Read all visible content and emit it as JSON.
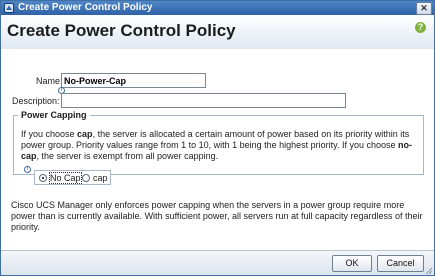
{
  "window": {
    "title": "Create Power Control Policy"
  },
  "header": {
    "title": "Create Power Control Policy"
  },
  "form": {
    "name_label": "Name:",
    "name_value": "No-Power-Cap",
    "description_label": "Description:",
    "description_value": ""
  },
  "power_capping": {
    "legend": "Power Capping",
    "text_1": "If you choose ",
    "bold_1": "cap",
    "text_2": ", the server is allocated a certain amount of power based on its priority within its power group. Priority values range from 1 to 10, with 1 being the highest priority. If you choose ",
    "bold_2": "no-cap",
    "text_3": ", the server is exempt from all power capping.",
    "options": [
      "No Cap",
      "cap"
    ],
    "selected": "No Cap"
  },
  "note": "Cisco UCS Manager only enforces power capping when the servers in a power group require more power than is currently available. With sufficient power, all servers run at full capacity regardless of their priority.",
  "buttons": {
    "ok": "OK",
    "cancel": "Cancel"
  },
  "icons": [
    "app-icon",
    "close-icon",
    "help-icon",
    "info-icon",
    "resize-grip-icon"
  ],
  "colors": {
    "titlebar": "#2f62a6",
    "help": "#7fb23c"
  }
}
